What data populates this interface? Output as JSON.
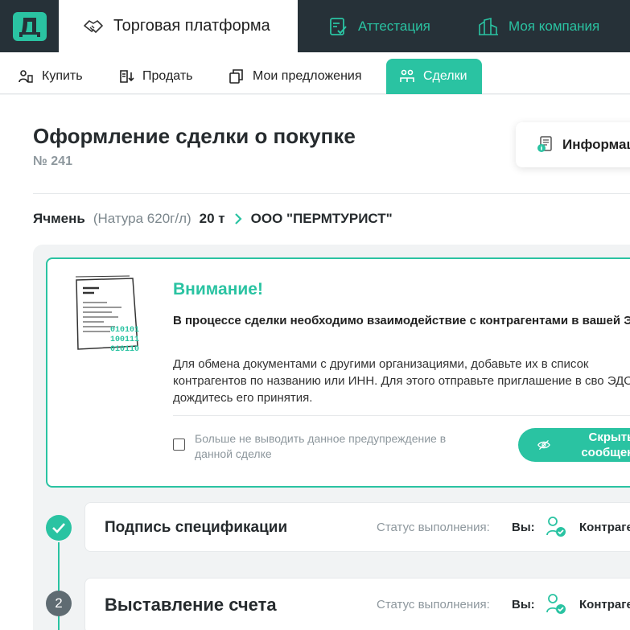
{
  "header": {
    "logo_alt": "Д",
    "tabs": [
      {
        "label": "Торговая платформа",
        "icon": "handshake-icon",
        "active": true
      },
      {
        "label": "Аттестация",
        "icon": "checklist-icon",
        "active": false
      },
      {
        "label": "Моя компания",
        "icon": "buildings-icon",
        "active": false
      }
    ]
  },
  "subnav": {
    "items": [
      {
        "label": "Купить",
        "icon": "buy-icon"
      },
      {
        "label": "Продать",
        "icon": "sell-icon"
      },
      {
        "label": "Мои предложения",
        "icon": "offers-icon"
      },
      {
        "label": "Сделки",
        "icon": "deals-icon",
        "active": true
      }
    ]
  },
  "page": {
    "title": "Оформление сделки о покупке",
    "deal_number": "№ 241",
    "info_button": "Информац"
  },
  "product": {
    "name": "Ячмень",
    "spec": "(Натура 620г/л)",
    "quantity": "20 т",
    "counterparty": "ООО \"ПЕРМТУРИСТ\""
  },
  "alert": {
    "title": "Внимание!",
    "bold_text": "В процессе сделки необходимо взаимодействие с контрагентами в вашей ЭДО",
    "text": "Для обмена документами с другими организациями, добавьте их в список контрагентов по названию или ИНН. Для этого отправьте приглашение в сво ЭДО и дождитесь его принятия.",
    "checkbox_label": "Больше не выводить данное предупреждение в данной сделке",
    "checkbox_checked": false,
    "hide_button": "Скрыть сообщени",
    "illustration_binary": [
      "010101",
      "100111",
      "010110"
    ]
  },
  "steps": [
    {
      "title": "Подпись спецификации",
      "status_label": "Статус выполнения:",
      "you_label": "Вы:",
      "counterparty_label": "Контраге",
      "state": "done"
    },
    {
      "number": "2",
      "title": "Выставление счета",
      "status_label": "Статус выполнения:",
      "you_label": "Вы:",
      "counterparty_label": "Контраге",
      "state": "pending"
    }
  ],
  "colors": {
    "accent": "#2ac3a2",
    "header_bg": "#263138",
    "step_pending": "#5f6b72",
    "muted_text": "#8d979d"
  }
}
